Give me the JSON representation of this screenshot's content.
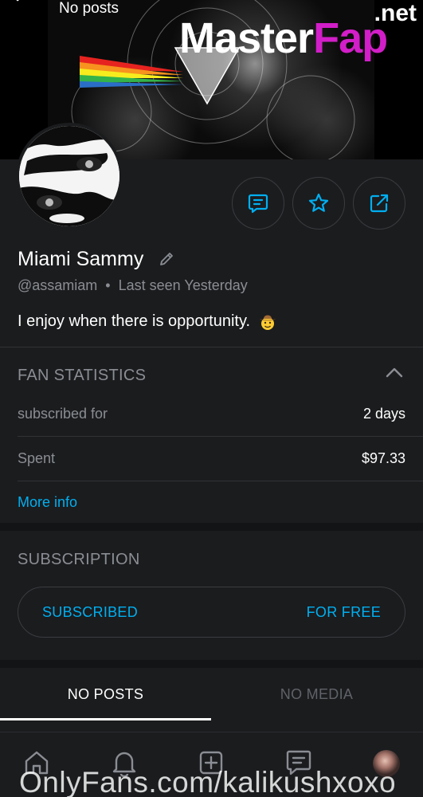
{
  "header": {
    "title": "No posts",
    "back_icon": "back-arrow-icon"
  },
  "watermark": {
    "main_white": "Master",
    "main_accent": "Fap",
    "tld": ".net",
    "accent_color": "#d21ec8",
    "bottom_text": "OnlyFans.com/kalikushxoxo"
  },
  "actions": [
    {
      "icon": "message-icon"
    },
    {
      "icon": "star-icon"
    },
    {
      "icon": "share-icon"
    }
  ],
  "profile": {
    "name": "Miami Sammy",
    "handle": "@assamiam",
    "separator": "•",
    "last_seen": "Last seen Yesterday",
    "bio": "I enjoy when there is opportunity.",
    "bio_emoji": "cowboy-face-emoji"
  },
  "fan_statistics": {
    "title": "FAN STATISTICS",
    "rows": [
      {
        "label": "subscribed for",
        "value": "2 days"
      },
      {
        "label": "Spent",
        "value": "$97.33"
      }
    ],
    "more_info": "More info"
  },
  "subscription": {
    "title": "SUBSCRIPTION",
    "status": "SUBSCRIBED",
    "price": "FOR FREE"
  },
  "tabs": [
    {
      "label": "NO POSTS",
      "active": true
    },
    {
      "label": "NO MEDIA",
      "active": false
    }
  ],
  "bottom_nav": [
    {
      "icon": "home-icon"
    },
    {
      "icon": "bell-icon"
    },
    {
      "icon": "add-post-icon"
    },
    {
      "icon": "messages-icon"
    },
    {
      "icon": "profile-avatar"
    }
  ],
  "colors": {
    "background": "#1b1c1e",
    "accent": "#00aff0",
    "muted_text": "#8a8d93",
    "divider": "#303236"
  }
}
